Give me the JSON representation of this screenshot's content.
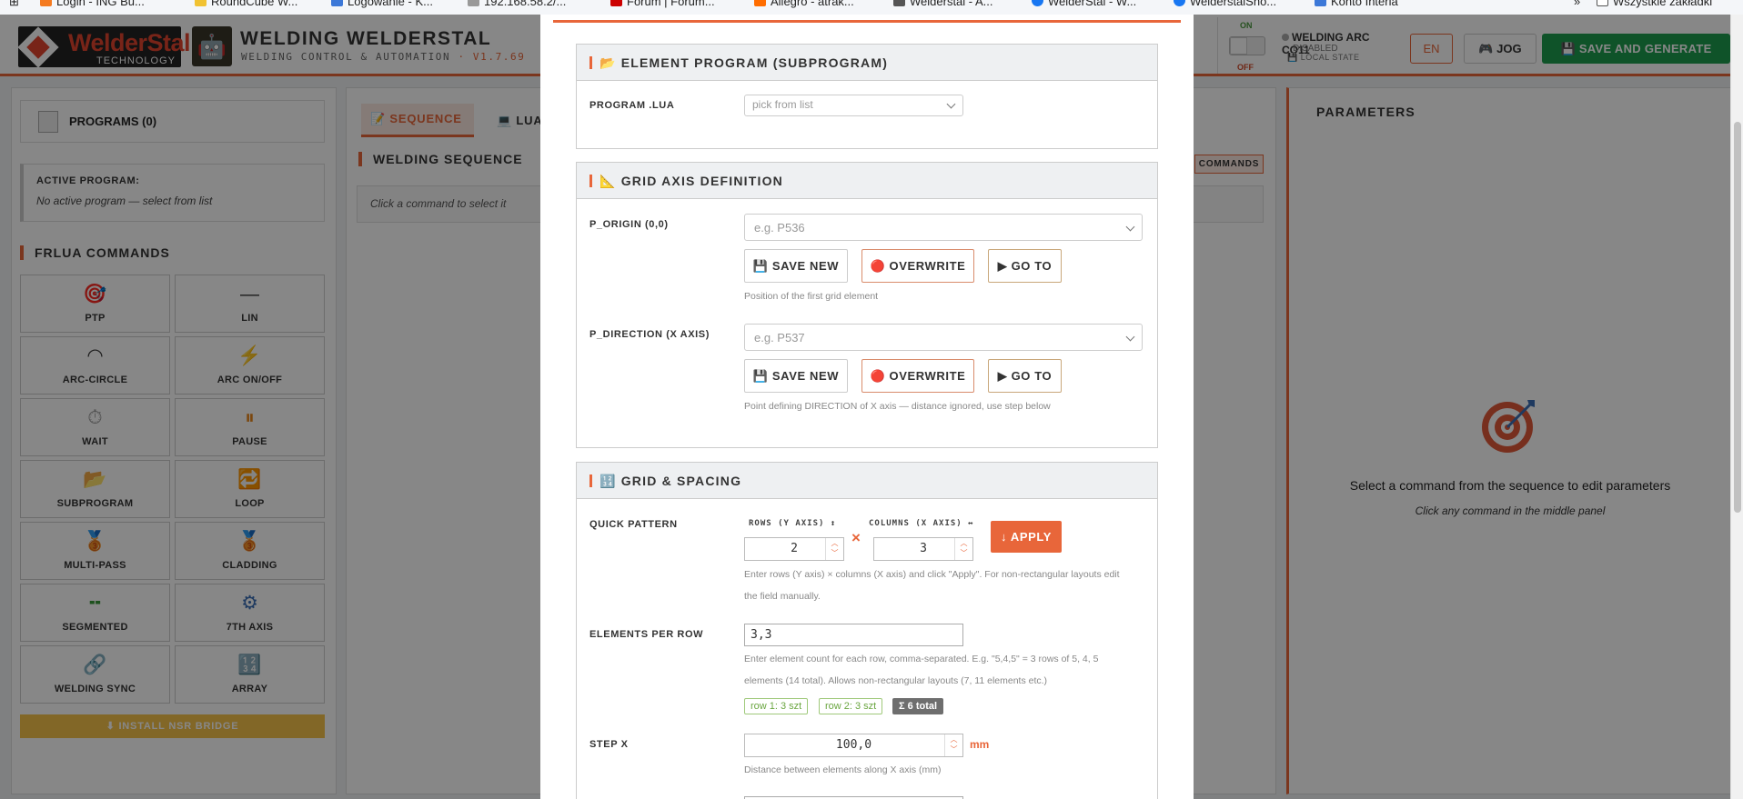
{
  "bookmarks": [
    {
      "label": "Login - ING Bu...",
      "color": "#f47a20"
    },
    {
      "label": "RoundCube W...",
      "color": "#f1c232"
    },
    {
      "label": "Logowanie - K...",
      "color": "#3c78d8"
    },
    {
      "label": "192.168.58.2/...",
      "color": "#999999"
    },
    {
      "label": "Forum | Forum...",
      "color": "#cc0000"
    },
    {
      "label": "Allegro - atrak...",
      "color": "#ff6d00"
    },
    {
      "label": "Welderstal - A...",
      "color": "#555555"
    },
    {
      "label": "WelderStal - W...",
      "color": "#1877f2"
    },
    {
      "label": "WelderstalSho...",
      "color": "#1877f2"
    },
    {
      "label": "Konto Interia",
      "color": "#3c78d8"
    },
    {
      "label": "»",
      "color": ""
    },
    {
      "label": "Wszystkie zakładki",
      "color": "#555555"
    }
  ],
  "header": {
    "logo_main": "WelderStal",
    "logo_sub": "TECHNOLOGY",
    "title": "WELDING WELDERSTAL",
    "subtitle": "WELDING CONTROL & AUTOMATION",
    "version": "· V1.7.69",
    "toggle_on": "ON",
    "toggle_off": "OFF",
    "arc_name": "WELDING ARC CO11",
    "arc_status": "· DISABLED",
    "arc_state": "💾 LOCAL STATE",
    "lang": "EN",
    "jog": "🎮 JOG",
    "save": "💾 SAVE AND GENERATE"
  },
  "left": {
    "programs": "PROGRAMS (0)",
    "active_label": "ACTIVE PROGRAM:",
    "active_value": "No active program — select from list",
    "commands_title": "FRLUA COMMANDS",
    "commands": [
      {
        "icon": "🎯",
        "label": "PTP"
      },
      {
        "icon": "—",
        "label": "LIN"
      },
      {
        "icon": "◠",
        "label": "ARC-CIRCLE"
      },
      {
        "icon": "⚡",
        "label": "ARC ON/OFF"
      },
      {
        "icon": "⏱",
        "label": "WAIT"
      },
      {
        "icon": "⏸",
        "label": "PAUSE"
      },
      {
        "icon": "📂",
        "label": "SUBPROGRAM"
      },
      {
        "icon": "🔁",
        "label": "LOOP"
      },
      {
        "icon": "🥉",
        "label": "MULTI-PASS"
      },
      {
        "icon": "🥉",
        "label": "CLADDING"
      },
      {
        "icon": "╍",
        "label": "SEGMENTED"
      },
      {
        "icon": "⚙",
        "label": "7TH AXIS"
      },
      {
        "icon": "🔗",
        "label": "WELDING SYNC"
      },
      {
        "icon": "🔢",
        "label": "ARRAY"
      }
    ],
    "install": "⬇ INSTALL NSR BRIDGE"
  },
  "middle": {
    "tab_sequence": "📝 SEQUENCE",
    "tab_lua": "💻 LUA",
    "seq_title": "WELDING SEQUENCE",
    "commands_btn": "COMMANDS",
    "seq_hint": "Click a command to select it"
  },
  "right": {
    "title": "PARAMETERS",
    "msg": "Select a command from the sequence to edit parameters",
    "hint": "Click any command in the middle panel"
  },
  "modal": {
    "element_program": {
      "title": "📂 ELEMENT PROGRAM (SUBPROGRAM)",
      "label": "PROGRAM .LUA",
      "placeholder": "pick from list"
    },
    "grid_axis": {
      "title": "📐 GRID AXIS DEFINITION",
      "origin_label": "P_ORIGIN (0,0)",
      "origin_placeholder": "e.g. P536",
      "direction_label": "P_DIRECTION (X AXIS)",
      "direction_placeholder": "e.g. P537",
      "save_new": "💾 SAVE NEW",
      "overwrite": "🔴 OVERWRITE",
      "goto": "▶ GO TO",
      "origin_hint": "Position of the first grid element",
      "direction_hint": "Point defining DIRECTION of X axis — distance ignored, use step below"
    },
    "grid_spacing": {
      "title": "🔢 GRID & SPACING",
      "quick_pattern": "QUICK PATTERN",
      "rows_label": "ROWS (Y AXIS) ↕",
      "cols_label": "COLUMNS (X AXIS) ↔",
      "rows": "2",
      "cols": "3",
      "times": "×",
      "apply": "↓ APPLY",
      "pattern_hint_1": "Enter rows (Y axis) × columns (X axis) and click \"Apply\". For non-rectangular layouts edit",
      "pattern_hint_2": "the field manually.",
      "epr_label": "ELEMENTS PER ROW",
      "epr_value": "3,3",
      "epr_hint_1": "Enter element count for each row, comma-separated. E.g. \"5,4,5\" = 3 rows of 5, 4, 5",
      "epr_hint_2": "elements (14 total). Allows non-rectangular layouts (7, 11 elements etc.)",
      "chip_row1": "row 1: 3 szt",
      "chip_row2": "row 2: 3 szt",
      "chip_total": "Σ 6 total",
      "step_x_label": "STEP X",
      "step_x_value": "100,0",
      "step_x_unit": "mm",
      "step_x_hint": "Distance between elements along X axis (mm)"
    }
  }
}
